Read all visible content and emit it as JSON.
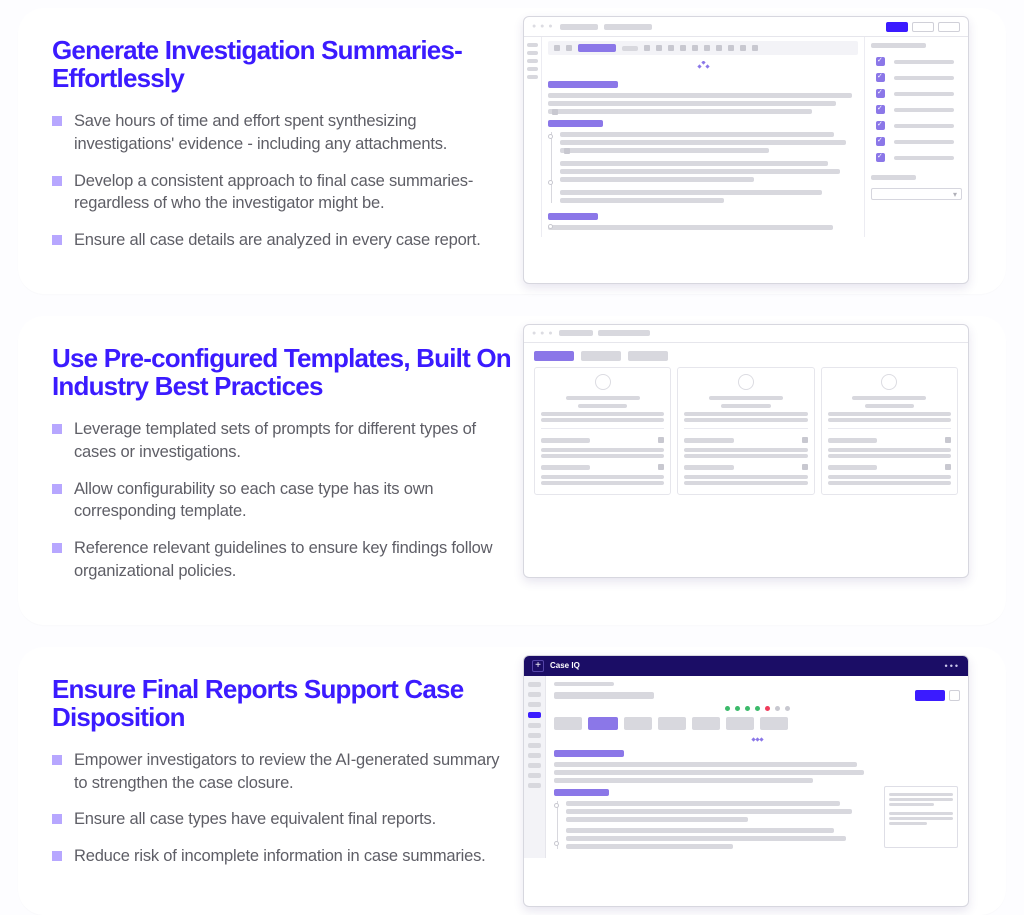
{
  "sections": [
    {
      "title": "Generate Investigation Summaries- Effortlessly",
      "bullets": [
        "Save hours of time and effort spent synthesizing investigations' evidence - including any attachments.",
        "Develop a consistent approach to final case summaries- regardless of who the investigator might be.",
        "Ensure all case details are analyzed in every case report."
      ]
    },
    {
      "title": "Use Pre-configured Templates, Built On Industry Best Practices",
      "bullets": [
        "Leverage templated sets of prompts for different types of cases or investigations.",
        "Allow configurability so each case type has its own corresponding template.",
        "Reference relevant guidelines to ensure key findings follow organizational policies."
      ]
    },
    {
      "title": "Ensure Final Reports Support Case Disposition",
      "bullets": [
        "Empower investigators to review the AI-generated summary to strengthen the case closure.",
        "Ensure all case types have equivalent final reports.",
        "Reduce risk of incomplete  information in case summaries."
      ]
    }
  ],
  "mock3": {
    "app_name": "Case IQ"
  }
}
